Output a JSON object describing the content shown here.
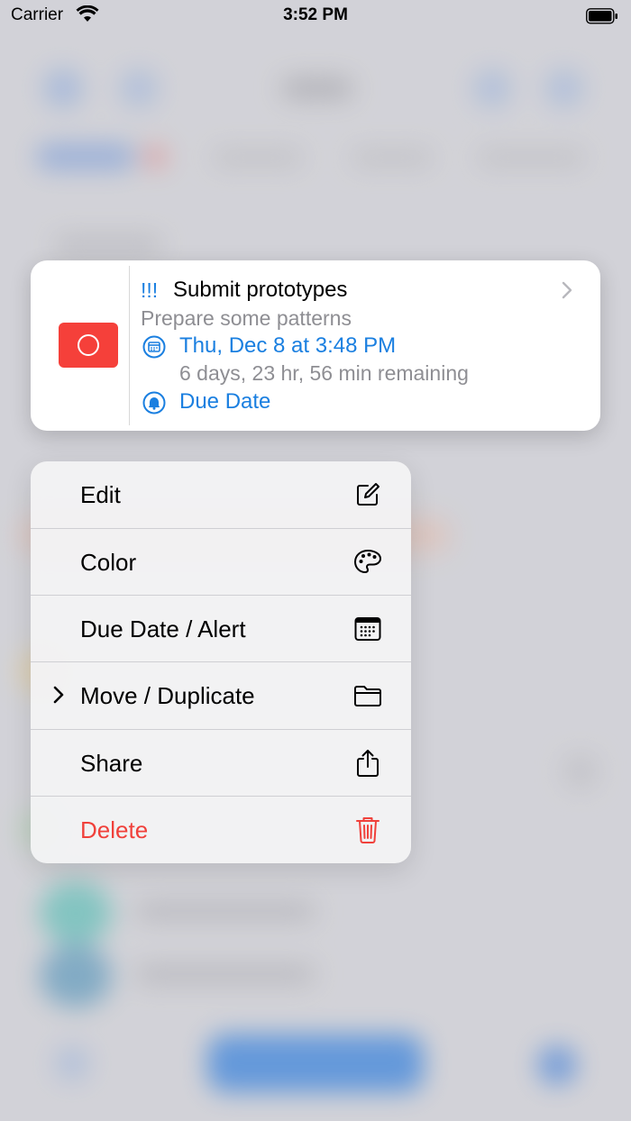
{
  "status_bar": {
    "carrier": "Carrier",
    "time": "3:52 PM"
  },
  "preview": {
    "flag_color": "#f5403a",
    "priority": "!!!",
    "title": "Submit prototypes",
    "notes": "Prepare some patterns",
    "due": "Thu, Dec 8 at 3:48 PM",
    "remaining": "6 days, 23 hr, 56 min remaining",
    "alert": "Due Date",
    "accent_color": "#1a7fe0"
  },
  "menu": {
    "items": [
      {
        "label": "Edit",
        "icon": "edit-icon"
      },
      {
        "label": "Color",
        "icon": "palette-icon"
      },
      {
        "label": "Due Date / Alert",
        "icon": "calendar-icon"
      },
      {
        "label": "Move / Duplicate",
        "icon": "folder-icon",
        "submenu": true
      },
      {
        "label": "Share",
        "icon": "share-icon"
      },
      {
        "label": "Delete",
        "icon": "trash-icon",
        "destructive": true,
        "color": "#f0413b"
      }
    ]
  }
}
